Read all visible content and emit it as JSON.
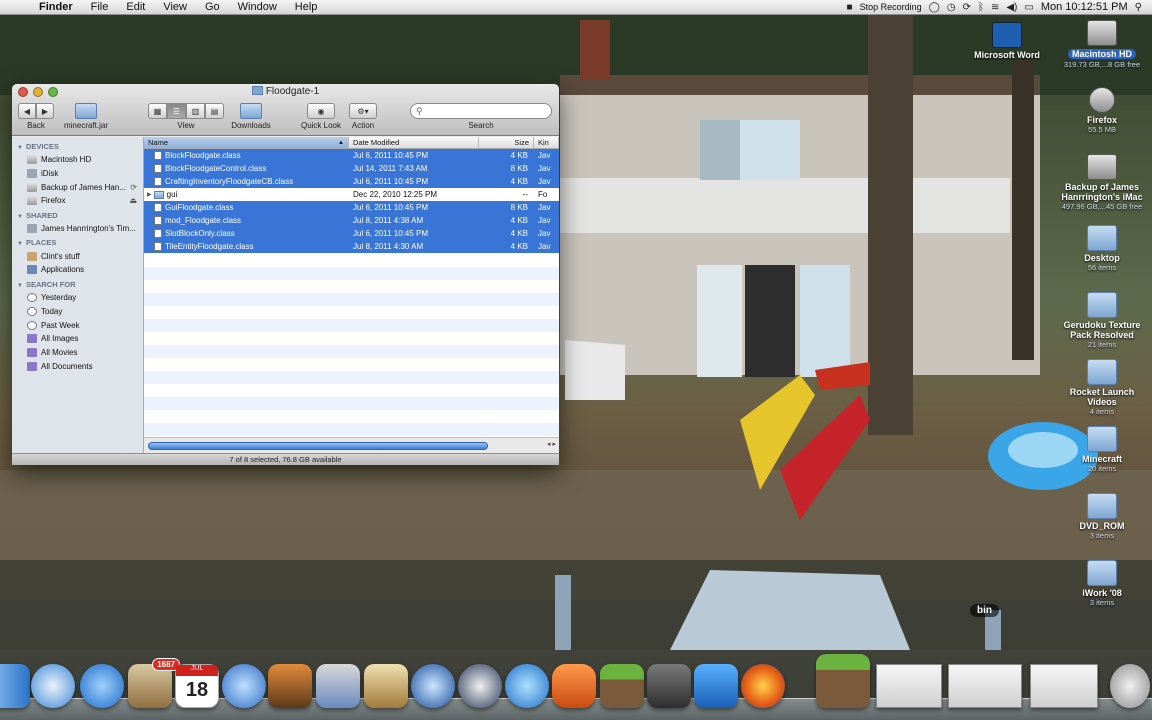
{
  "menubar": {
    "app_name": "Finder",
    "menus": [
      "File",
      "Edit",
      "View",
      "Go",
      "Window",
      "Help"
    ],
    "status_text": "Stop Recording",
    "clock": "Mon 10:12:51 PM"
  },
  "desktop_items": [
    {
      "name": "Microsoft Word",
      "sub": "",
      "icon": "word-icon"
    },
    {
      "name": "Macintosh HD",
      "sub": "319.73 GB,...8 GB free",
      "icon": "hard-disk-icon"
    },
    {
      "name": "Firefox",
      "sub": "55.5 MB",
      "icon": "disk-image-icon"
    },
    {
      "name": "Backup of James Hanrrington's iMac",
      "sub": "497.96 GB,...45 GB free",
      "icon": "time-machine-icon"
    },
    {
      "name": "Desktop",
      "sub": "56 items",
      "icon": "folder-icon"
    },
    {
      "name": "Gerudoku Texture Pack Resolved",
      "sub": "21 items",
      "icon": "folder-icon"
    },
    {
      "name": "Rocket Launch Videos",
      "sub": "4 items",
      "icon": "folder-icon"
    },
    {
      "name": "Minecraft",
      "sub": "20 items",
      "icon": "folder-icon"
    },
    {
      "name": "DVD_ROM",
      "sub": "3 items",
      "icon": "folder-icon"
    },
    {
      "name": "iWork '08",
      "sub": "3 items",
      "icon": "folder-icon"
    }
  ],
  "window": {
    "title": "Floodgate-1",
    "toolbar": {
      "back_label": "Back",
      "path_label": "minecraft.jar",
      "view_label": "View",
      "downloads_label": "Downloads",
      "quicklook_label": "Quick Look",
      "action_label": "Action",
      "search_label": "Search",
      "search_placeholder": ""
    },
    "sidebar": {
      "devices_label": "DEVICES",
      "devices": [
        "Macintosh HD",
        "iDisk",
        "Backup of James Han...",
        "Firefox"
      ],
      "shared_label": "SHARED",
      "shared": [
        "James Hanrrington's Tim..."
      ],
      "places_label": "PLACES",
      "places": [
        "Clint's stuff",
        "Applications"
      ],
      "search_label": "SEARCH FOR",
      "search_for": [
        "Yesterday",
        "Today",
        "Past Week",
        "All Images",
        "All Movies",
        "All Documents"
      ]
    },
    "columns": {
      "name": "Name",
      "date": "Date Modified",
      "size": "Size",
      "kind": "Kin"
    },
    "files": [
      {
        "name": "BlockFloodgate.class",
        "date": "Jul 6, 2011 10:45 PM",
        "size": "4 KB",
        "kind": "Jav",
        "selected": true,
        "folder": false
      },
      {
        "name": "BlockFloodgateControl.class",
        "date": "Jul 14, 2011 7:43 AM",
        "size": "8 KB",
        "kind": "Jav",
        "selected": true,
        "folder": false
      },
      {
        "name": "CraftingInventoryFloodgateCB.class",
        "date": "Jul 6, 2011 10:45 PM",
        "size": "4 KB",
        "kind": "Jav",
        "selected": true,
        "folder": false
      },
      {
        "name": "gui",
        "date": "Dec 22, 2010 12:25 PM",
        "size": "--",
        "kind": "Fo",
        "selected": false,
        "folder": true
      },
      {
        "name": "GuiFloodgate.class",
        "date": "Jul 6, 2011 10:45 PM",
        "size": "8 KB",
        "kind": "Jav",
        "selected": true,
        "folder": false
      },
      {
        "name": "mod_Floodgate.class",
        "date": "Jul 8, 2011 4:38 AM",
        "size": "4 KB",
        "kind": "Jav",
        "selected": true,
        "folder": false
      },
      {
        "name": "SlotBlockOnly.class",
        "date": "Jul 6, 2011 10:45 PM",
        "size": "4 KB",
        "kind": "Jav",
        "selected": true,
        "folder": false
      },
      {
        "name": "TileEntityFloodgate.class",
        "date": "Jul 8, 2011 4:30 AM",
        "size": "4 KB",
        "kind": "Jav",
        "selected": true,
        "folder": false
      }
    ],
    "status": "7 of 8 selected, 76.8 GB available"
  },
  "dock": {
    "apps": [
      "finder-icon",
      "safari-icon",
      "app-store-icon",
      "mail-stamp-icon",
      "ical-icon",
      "ichat-icon",
      "photo-booth-icon",
      "iphoto-icon",
      "preview-icon",
      "quicktime-icon",
      "dvd-player-icon",
      "itunes-icon",
      "office-icon",
      "minecraft-icon",
      "steam-icon",
      "word-icon",
      "firefox-icon",
      "minecraft-block-icon"
    ],
    "mail_badge": "1687",
    "calendar_month": "JUL",
    "calendar_day": "18",
    "hover_label": "bin"
  },
  "colors": {
    "selection": "#3875d7",
    "menubar": "#e6e6e6"
  }
}
